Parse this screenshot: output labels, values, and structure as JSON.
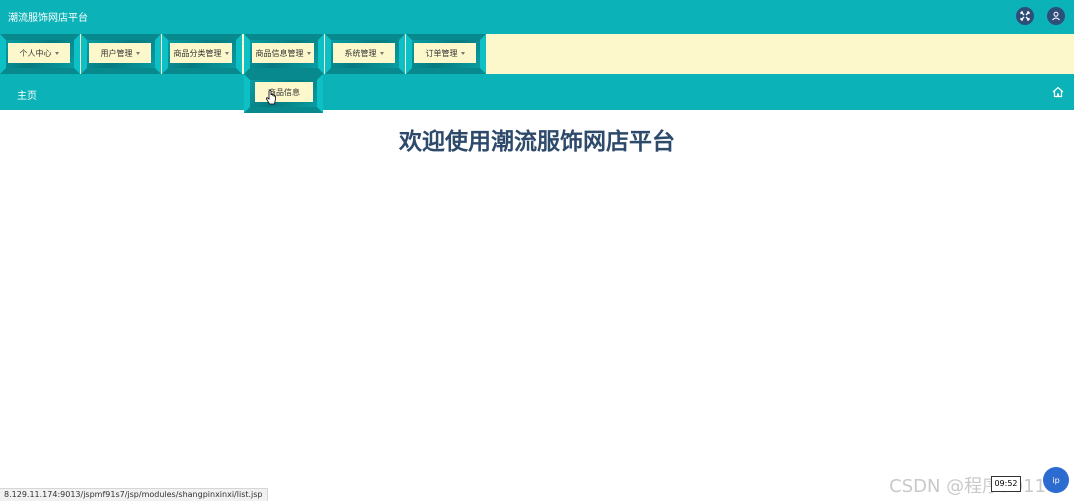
{
  "header": {
    "title": "潮流服饰网店平台"
  },
  "nav": {
    "items": [
      {
        "label": "个人中心"
      },
      {
        "label": "用户管理"
      },
      {
        "label": "商品分类管理"
      },
      {
        "label": "商品信息管理"
      },
      {
        "label": "系统管理"
      },
      {
        "label": "订单管理"
      }
    ],
    "dropdown": {
      "item": "商品信息"
    }
  },
  "breadcrumb": {
    "home": "主页"
  },
  "main": {
    "welcome": "欢迎使用潮流服饰网店平台"
  },
  "status": {
    "url": "8.129.11.174:9013/jspmf91s7/jsp/modules/shangpinxinxi/list.jsp"
  },
  "overlay": {
    "watermark": "CSDN @程序3011",
    "time": "09:52",
    "float_label": "ip"
  },
  "colors": {
    "accent": "#0bb2b8",
    "nav_bg": "#fdf8cc",
    "title_text": "#2d4a6b"
  },
  "icons": {
    "fullscreen": "fullscreen-icon",
    "user": "user-icon",
    "home": "home-icon"
  }
}
